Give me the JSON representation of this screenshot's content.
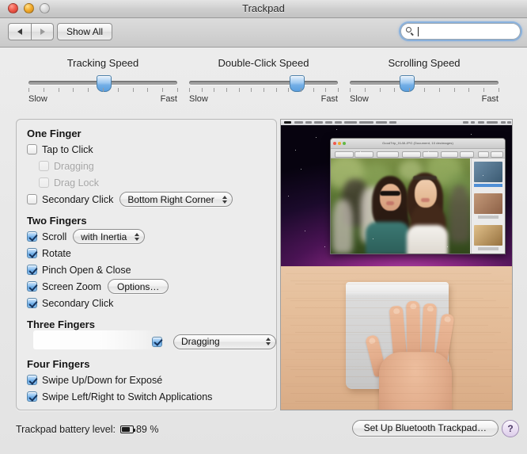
{
  "window": {
    "title": "Trackpad",
    "traffic_lights": [
      "close",
      "minimize",
      "zoom"
    ]
  },
  "toolbar": {
    "back_icon": "back-arrow-icon",
    "forward_icon": "forward-arrow-icon",
    "show_all_label": "Show All",
    "search": {
      "value": "",
      "placeholder": "",
      "icon": "search-icon"
    }
  },
  "sliders": [
    {
      "name": "tracking-speed",
      "title": "Tracking Speed",
      "low": "Slow",
      "high": "Fast",
      "ticks": 11,
      "value_index": 6,
      "percent": 50
    },
    {
      "name": "double-click-speed",
      "title": "Double-Click Speed",
      "low": "Slow",
      "high": "Fast",
      "ticks": 13,
      "value_index": 10,
      "percent": 72
    },
    {
      "name": "scrolling-speed",
      "title": "Scrolling Speed",
      "low": "Slow",
      "high": "Fast",
      "ticks": 11,
      "value_index": 5,
      "percent": 38
    }
  ],
  "gestures": {
    "groups": [
      {
        "heading": "One Finger",
        "rows": [
          {
            "name": "tap-to-click",
            "label": "Tap to Click",
            "checked": false,
            "disabled": false,
            "indent": false
          },
          {
            "name": "dragging",
            "label": "Dragging",
            "checked": false,
            "disabled": true,
            "indent": true
          },
          {
            "name": "drag-lock",
            "label": "Drag Lock",
            "checked": false,
            "disabled": true,
            "indent": true
          },
          {
            "name": "secondary-click",
            "label": "Secondary Click",
            "checked": false,
            "disabled": false,
            "indent": false,
            "popup": {
              "name": "secondary-click-location-popup",
              "value": "Bottom Right Corner"
            }
          }
        ]
      },
      {
        "heading": "Two Fingers",
        "rows": [
          {
            "name": "scroll",
            "label": "Scroll",
            "checked": true,
            "disabled": false,
            "indent": false,
            "popup": {
              "name": "scroll-inertia-popup",
              "value": "with Inertia"
            }
          },
          {
            "name": "rotate",
            "label": "Rotate",
            "checked": true,
            "disabled": false,
            "indent": false
          },
          {
            "name": "pinch-open-close",
            "label": "Pinch Open & Close",
            "checked": true,
            "disabled": false,
            "indent": false
          },
          {
            "name": "screen-zoom",
            "label": "Screen Zoom",
            "checked": true,
            "disabled": false,
            "indent": false,
            "button": {
              "name": "screen-zoom-options-button",
              "label": "Options…"
            }
          },
          {
            "name": "two-finger-secondary-click",
            "label": "Secondary Click",
            "checked": true,
            "disabled": false,
            "indent": false
          }
        ]
      },
      {
        "heading": "Three Fingers",
        "rows": [
          {
            "name": "three-finger-action",
            "label": "",
            "checked": true,
            "disabled": false,
            "indent": false,
            "highlighted": true,
            "popup": {
              "name": "three-finger-action-popup",
              "value": "Dragging"
            }
          }
        ]
      },
      {
        "heading": "Four Fingers",
        "rows": [
          {
            "name": "swipe-up-down-expose",
            "label": "Swipe Up/Down for Exposé",
            "checked": true,
            "disabled": false,
            "indent": false
          },
          {
            "name": "swipe-left-right-switch-apps",
            "label": "Swipe Left/Right to Switch Applications",
            "checked": true,
            "disabled": false,
            "indent": false
          }
        ]
      }
    ]
  },
  "preview": {
    "name": "gesture-demo-video",
    "top_scene": "macos-desktop-with-preview-app-showing-photo-of-two-women",
    "bottom_scene": "hand-resting-on-magic-trackpad-on-wooden-desk",
    "preview_window_title": "GoodTrip_0138.JPG (Document, 10 decimages)",
    "thumbnail_labels": [
      "GoodTrip_0138",
      "GoodTrip_0139",
      "GoodTrip_0140"
    ]
  },
  "footer": {
    "battery_label": "Trackpad battery level:",
    "battery_icon": "battery-icon",
    "battery_percent": "89 %",
    "battery_fill": 89,
    "setup_button": "Set Up Bluetooth Trackpad…",
    "help_button": "?"
  },
  "colors": {
    "accent": "#69a9e4",
    "window_bg": "#ededed",
    "panel_bg": "#ececec",
    "help_tint": "#ddcdea"
  }
}
